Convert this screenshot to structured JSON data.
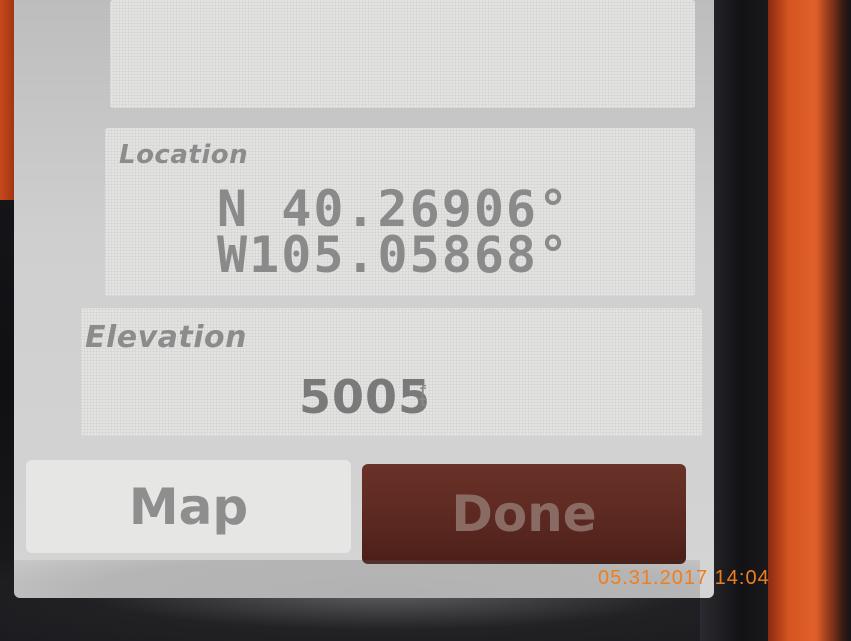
{
  "location": {
    "label": "Location",
    "lat_prefix": "N",
    "lat_value": "40.26906°",
    "lon_prefix": "W",
    "lon_value": "105.05868°"
  },
  "elevation": {
    "label": "Elevation",
    "value": "5005",
    "unit": "ft"
  },
  "buttons": {
    "map_label": "Map",
    "done_label": "Done"
  },
  "photo": {
    "timestamp": "05.31.2017 14:04"
  },
  "colors": {
    "casing": "#d5541f",
    "done_button": "#5a2820",
    "timestamp": "#f07e1e"
  }
}
